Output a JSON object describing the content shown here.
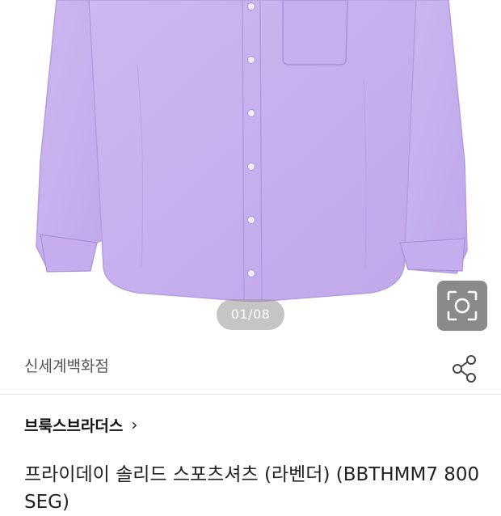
{
  "gallery": {
    "counter_text": "01/08",
    "shirt_color": "#c9b3ef",
    "lens_icon": "lens-search-icon"
  },
  "store": {
    "name": "신세계백화점",
    "share_icon": "share-icon"
  },
  "product": {
    "brand": "브룩스브라더스",
    "brand_chevron": "›",
    "title": "프라이데이 솔리드 스포츠셔츠 (라벤더) (BBTHMM7 800SEG)"
  }
}
